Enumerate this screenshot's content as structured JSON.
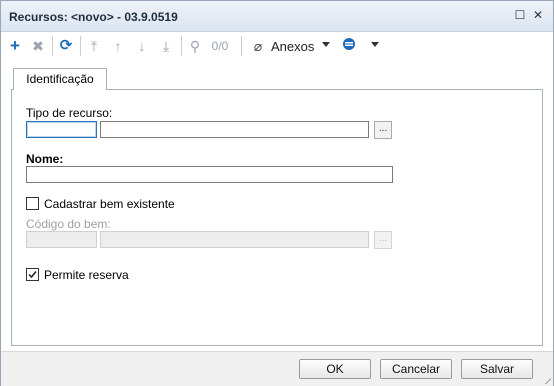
{
  "window": {
    "title": "Recursos: <novo> - 03.9.0519"
  },
  "toolbar": {
    "anexos_label": "Anexos",
    "page_indicator": "0/0"
  },
  "tabs": [
    {
      "label": "Identificação"
    }
  ],
  "form": {
    "tipo_recurso_label": "Tipo de recurso:",
    "nome_label": "Nome:",
    "cadastrar_label": "Cadastrar bem existente",
    "codigo_bem_label": "Código do bem:",
    "permite_reserva_label": "Permite reserva",
    "lookup_button": "...",
    "cadastrar_checked": false,
    "permite_reserva_checked": true
  },
  "footer": {
    "ok_label": "OK",
    "cancel_label": "Cancelar",
    "save_label": "Salvar"
  }
}
